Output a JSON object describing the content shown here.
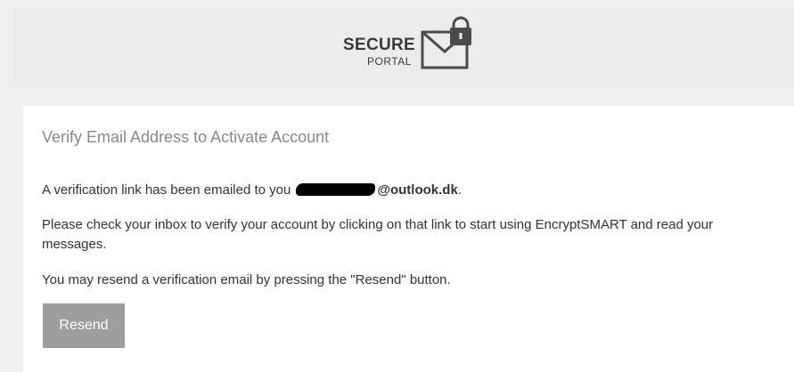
{
  "logo": {
    "word1": "SECURE",
    "word2": "PORTAL",
    "icon": "envelope-lock-icon"
  },
  "card": {
    "title": "Verify Email Address to Activate Account",
    "line1_prefix": "A verification link has been emailed to you",
    "line1_email_suffix": "@outlook.dk",
    "line1_end": ".",
    "line2": "Please check your inbox to verify your account by clicking on that link to start using EncryptSMART and read your messages.",
    "line3": "You may resend a verification email by pressing the \"Resend\" button.",
    "resend_label": "Resend"
  },
  "colors": {
    "button": "#9e9e9e",
    "title": "#888888",
    "header_bg": "#ececec"
  }
}
